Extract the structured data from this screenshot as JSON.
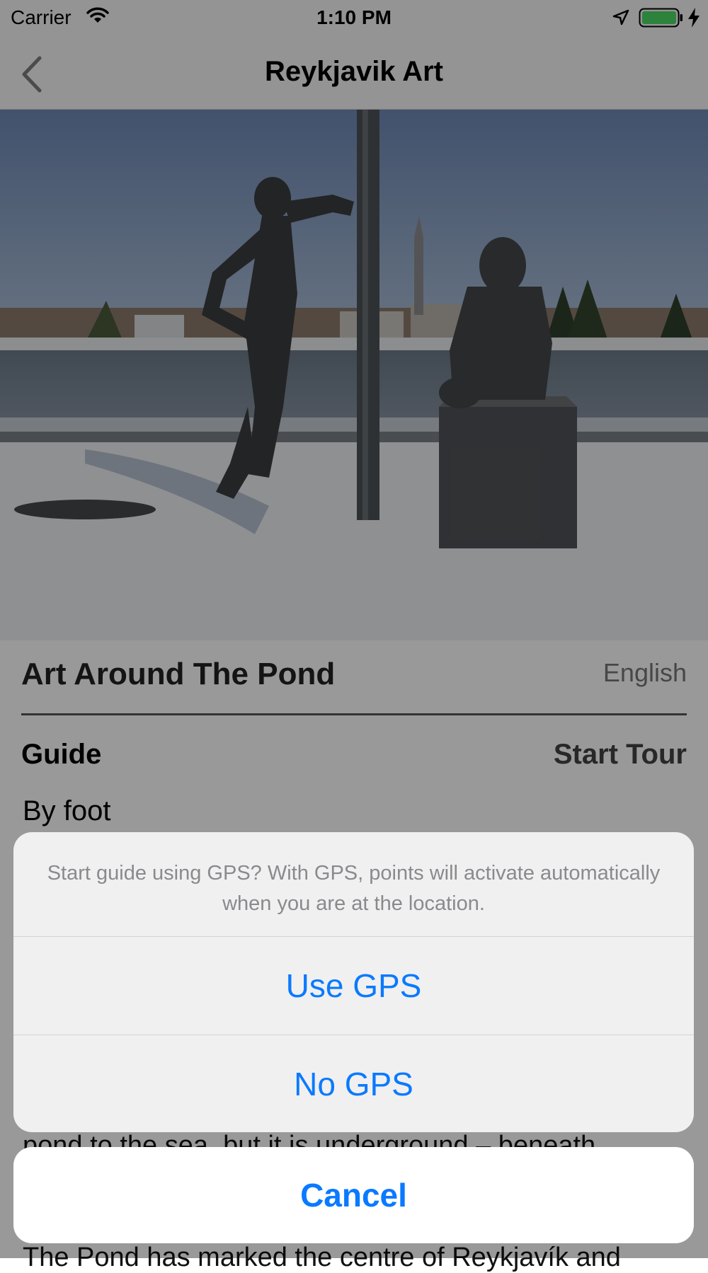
{
  "status_bar": {
    "carrier": "Carrier",
    "time": "1:10 PM",
    "battery_color": "#4cd964"
  },
  "nav": {
    "title": "Reykjavik Art",
    "back_icon": "chevron-left-icon"
  },
  "tour": {
    "title": "Art Around The Pond",
    "language": "English",
    "guide_label": "Guide",
    "start_tour": "Start Tour",
    "transport_mode": "By foot",
    "body_partial_1": "pond to the sea, but it is underground – beneath",
    "body_partial_2": "The Pond has marked the centre of Reykjavík and"
  },
  "action_sheet": {
    "message": "Start guide using GPS? With GPS, points will activate automatically when you are at the location.",
    "use_gps": "Use GPS",
    "no_gps": "No GPS",
    "cancel": "Cancel",
    "accent_color": "#0a7aff"
  }
}
